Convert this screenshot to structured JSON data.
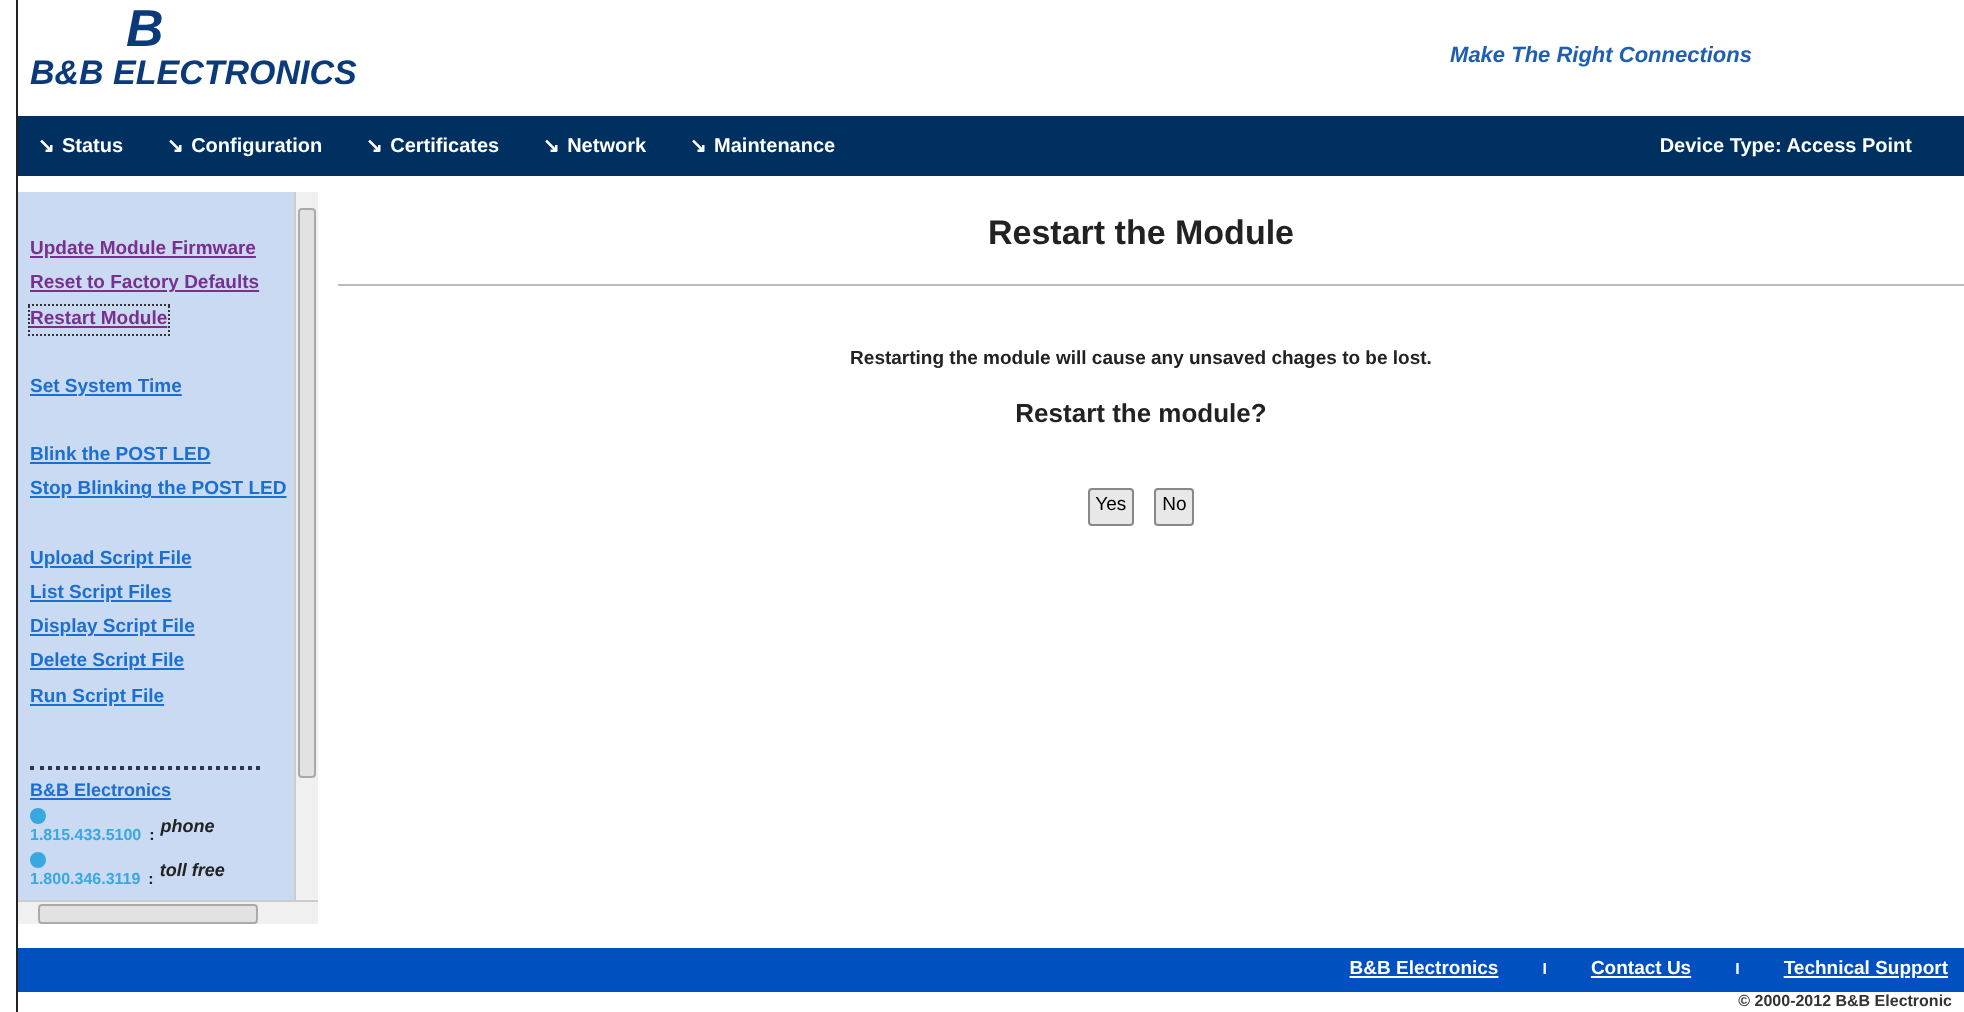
{
  "logo": {
    "mark": "B",
    "name": "B&B ELECTRONICS"
  },
  "tagline": "Make The Right Connections",
  "nav": {
    "items": [
      {
        "label": "Status",
        "icon": "↘"
      },
      {
        "label": "Configuration",
        "icon": "↘"
      },
      {
        "label": "Certificates",
        "icon": "↘"
      },
      {
        "label": "Network",
        "icon": "↘"
      },
      {
        "label": "Maintenance",
        "icon": "↘"
      }
    ],
    "device_type": "Device Type: Access Point"
  },
  "sidebar": {
    "groups": [
      [
        {
          "label": "Update Module Firmware",
          "visited": true,
          "focused": false
        },
        {
          "label": "Reset to Factory Defaults",
          "visited": true,
          "focused": false
        },
        {
          "label": "Restart Module",
          "visited": true,
          "focused": true
        }
      ],
      [
        {
          "label": "Set System Time",
          "visited": false,
          "focused": false
        }
      ],
      [
        {
          "label": "Blink the POST LED",
          "visited": false,
          "focused": false
        },
        {
          "label": "Stop Blinking the POST LED",
          "visited": false,
          "focused": false
        }
      ],
      [
        {
          "label": "Upload Script File",
          "visited": false,
          "focused": false
        },
        {
          "label": "List Script Files",
          "visited": false,
          "focused": false
        },
        {
          "label": "Display Script File",
          "visited": false,
          "focused": false
        },
        {
          "label": "Delete Script File",
          "visited": false,
          "focused": false
        },
        {
          "label": "Run Script File",
          "visited": false,
          "focused": false
        }
      ]
    ],
    "company": "B&B Electronics",
    "contacts": [
      {
        "number": "1.815.433.5100",
        "sep": ":",
        "label": "phone"
      },
      {
        "number": "1.800.346.3119",
        "sep": ":",
        "label": "toll free"
      }
    ]
  },
  "main": {
    "title": "Restart the Module",
    "warning": "Restarting the module will cause any unsaved chages to be lost.",
    "question": "Restart the module?",
    "buttons": [
      "Yes",
      "No"
    ]
  },
  "footer": {
    "links": [
      "B&B Electronics",
      "Contact Us",
      "Technical Support"
    ],
    "separators": [
      "I",
      "I"
    ],
    "copyright": "© 2000-2012 B&B Electronic"
  }
}
